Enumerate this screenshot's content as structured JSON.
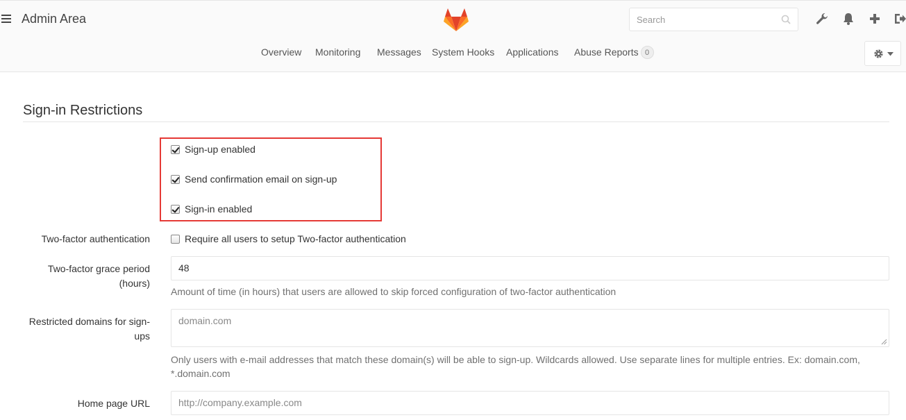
{
  "header": {
    "title": "Admin Area",
    "search_placeholder": "Search",
    "nav": [
      {
        "label": "Overview"
      },
      {
        "label": "Monitoring"
      },
      {
        "label": "Messages"
      },
      {
        "label": "System Hooks"
      },
      {
        "label": "Applications"
      },
      {
        "label": "Abuse Reports",
        "badge": "0"
      }
    ],
    "icons": [
      "menu-icon",
      "gitlab-logo",
      "search-icon",
      "wrench-icon",
      "bell-icon",
      "plus-icon",
      "sign-out-icon",
      "gear-icon",
      "caret-down-icon"
    ]
  },
  "section": {
    "title": "Sign-in Restrictions",
    "checkboxes": [
      {
        "label": "Sign-up enabled",
        "checked": true
      },
      {
        "label": "Send confirmation email on sign-up",
        "checked": true
      },
      {
        "label": "Sign-in enabled",
        "checked": true
      }
    ],
    "two_factor": {
      "label": "Two-factor authentication",
      "checkbox_label": "Require all users to setup Two-factor authentication",
      "checked": false
    },
    "grace_period": {
      "label_line1": "Two-factor grace period",
      "label_line2": "(hours)",
      "value": "48",
      "help": "Amount of time (in hours) that users are allowed to skip forced configuration of two-factor authentication"
    },
    "restricted_domains": {
      "label_line1": "Restricted domains for sign-",
      "label_line2": "ups",
      "placeholder": "domain.com",
      "help_line1": "Only users with e-mail addresses that match these domain(s) will be able to sign-up. Wildcards allowed. Use separate lines for multiple entries. Ex: domain.com,",
      "help_line2": "*.domain.com"
    },
    "home_page": {
      "label": "Home page URL",
      "placeholder": "http://company.example.com"
    }
  },
  "colors": {
    "highlight": "#e53935",
    "logo_orange": "#fc6d26",
    "logo_red": "#e24329",
    "logo_light": "#fca326"
  }
}
